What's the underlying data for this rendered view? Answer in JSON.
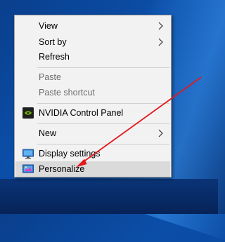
{
  "context_menu": {
    "items": [
      {
        "label": "View",
        "submenu": true
      },
      {
        "label": "Sort by",
        "submenu": true
      },
      {
        "label": "Refresh"
      },
      {
        "label": "Paste",
        "disabled": true
      },
      {
        "label": "Paste shortcut",
        "disabled": true
      },
      {
        "label": "NVIDIA Control Panel",
        "icon": "nvidia-icon"
      },
      {
        "label": "New",
        "submenu": true
      },
      {
        "label": "Display settings",
        "icon": "display-settings-icon"
      },
      {
        "label": "Personalize",
        "icon": "personalize-icon",
        "highlighted": true
      }
    ]
  },
  "colors": {
    "annotation_arrow": "#e0191f",
    "menu_background": "#f2f2f2",
    "highlight": "#dadada"
  }
}
